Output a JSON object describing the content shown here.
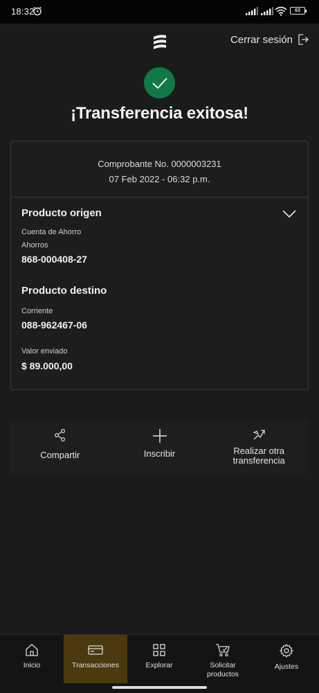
{
  "status_bar": {
    "time": "18:32",
    "battery": "63"
  },
  "header": {
    "logout_label": "Cerrar sesión"
  },
  "title": "¡Transferencia exitosa!",
  "receipt": {
    "number": "Comprobante No. 0000003231",
    "date": "07 Feb 2022 - 06:32 p.m."
  },
  "origin": {
    "title": "Producto origen",
    "account_type": "Cuenta de Ahorro",
    "account_kind": "Ahorros",
    "account_number": "868-000408-27"
  },
  "destination": {
    "title": "Producto destino",
    "account_type": "Corriente",
    "account_number": "088-962467-06"
  },
  "amount": {
    "label": "Valor enviado",
    "value": "$ 89.000,00"
  },
  "actions": {
    "share": "Compartir",
    "register": "Inscribir",
    "another_line1": "Realizar otra",
    "another_line2": "transferencia"
  },
  "nav": {
    "items": [
      {
        "label": "Inicio",
        "icon": "home-icon"
      },
      {
        "label": "Transacciones",
        "icon": "transactions-icon",
        "active": true
      },
      {
        "label": "Explorar",
        "icon": "grid-icon"
      },
      {
        "label": "Solicitar",
        "label2": "productos",
        "icon": "cart-icon"
      },
      {
        "label": "Ajustes",
        "icon": "gear-icon"
      }
    ]
  },
  "colors": {
    "accent_green": "#0f7a47",
    "active_nav": "#4a3a0e",
    "background": "#1b1b1b"
  }
}
